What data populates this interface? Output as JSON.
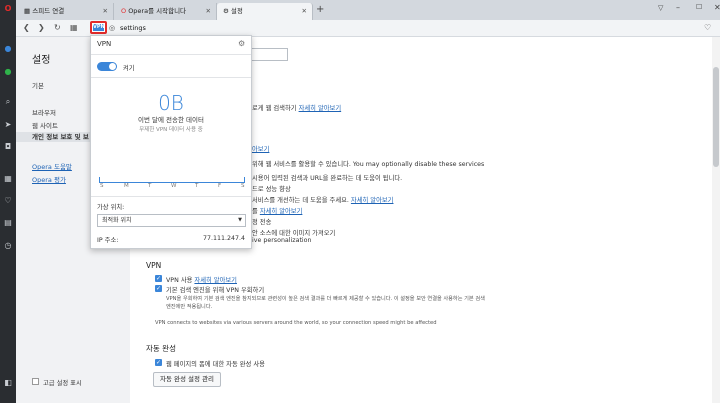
{
  "tabs": [
    {
      "label": "스피드 연결"
    },
    {
      "label": "Opera를 시작합니다"
    },
    {
      "label": "설정"
    }
  ],
  "toolbar": {
    "vpn_badge": "VPN",
    "url": "settings"
  },
  "sidebar": {
    "title": "설정",
    "items": [
      "기본",
      "브라우저",
      "웹 사이트",
      "개인 정보 보호 및 보"
    ],
    "links": [
      "Opera 도움말",
      "Opera 평가"
    ],
    "advanced_label": "고급 설정 표시"
  },
  "main": {
    "bg_lines": [
      "로게 웹 검색하기",
      "아보기",
      "위해 웹 서비스를 활용할 수 있습니다. You may optionally disable these services",
      "시용어 입력된 검색과 URL을 완료하는 데 도움이 됩니다.",
      "드로 성능 향상",
      "서비스를 개선하는 데 도움을 주세요.",
      "를",
      "정 전송",
      "안 소스에 대한 이미지 가져오기",
      "ive personalization"
    ],
    "learn_more": "자세히 알아보기",
    "vpn_section": {
      "title": "VPN",
      "enable_label": "VPN 사용",
      "enable_link": "자세히 알아보기",
      "bypass_label": "기본 검색 엔진을 위해 VPN 우회하기",
      "bypass_desc_1": "VPN을 우회하여 기본 검색 엔진을 참지되므로 관련성이 높은 검색 결과를 더 빠르게 제공할 수 있습니다. 이 설정을 보안 연결을 사용하는 기본 검색",
      "bypass_desc_2": "엔진에만 적용됩니다.",
      "note": "VPN connects to websites via various servers around the world, so your connection speed might be affected"
    },
    "autofill": {
      "title": "자동 완성",
      "check_label": "웹 페이지의 폼에 대한 자동 완성 사용",
      "button": "자동 완성 설정 관리"
    }
  },
  "vpn_popup": {
    "title": "VPN",
    "toggle_label": "켜기",
    "data_value": "0B",
    "data_caption": "이번 달에 전송한 데이터",
    "data_sub": "무제한 VPN 데이터 사용 중",
    "days": [
      "S",
      "M",
      "T",
      "W",
      "T",
      "F",
      "S"
    ],
    "location_label": "가상 위치:",
    "location_value": "최적화 위치",
    "ip_label": "IP 주소:",
    "ip_value": "77.111.247.4"
  },
  "colors": {
    "accent": "#3b86d9",
    "highlight": "#e32b2b",
    "sidebar_bg": "#f1f2f4",
    "dark_bar": "#2a2d31"
  }
}
